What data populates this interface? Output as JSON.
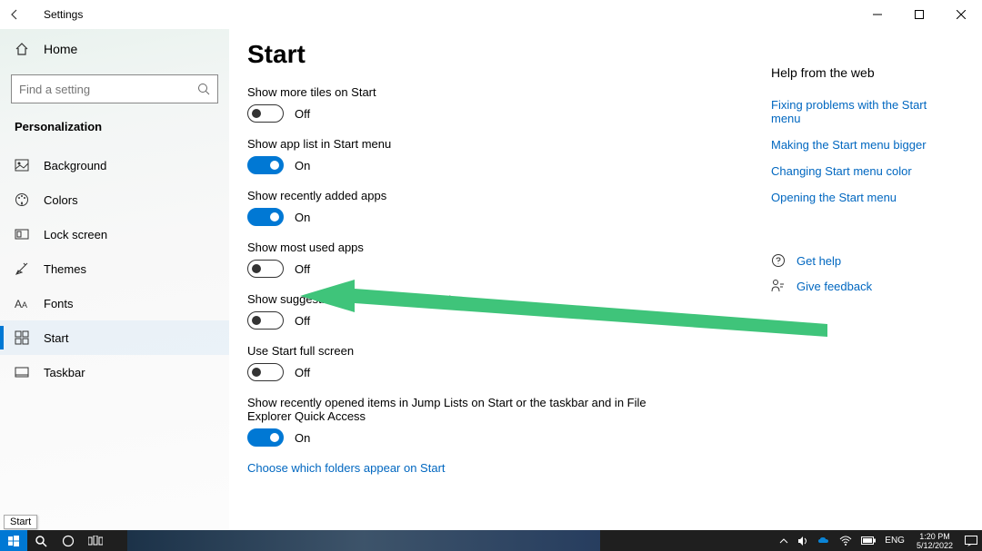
{
  "titlebar": {
    "title": "Settings"
  },
  "sidebar": {
    "home": "Home",
    "search_placeholder": "Find a setting",
    "category": "Personalization",
    "items": [
      {
        "label": "Background",
        "icon": "image"
      },
      {
        "label": "Colors",
        "icon": "palette"
      },
      {
        "label": "Lock screen",
        "icon": "lock"
      },
      {
        "label": "Themes",
        "icon": "brush"
      },
      {
        "label": "Fonts",
        "icon": "font"
      },
      {
        "label": "Start",
        "icon": "start",
        "active": true
      },
      {
        "label": "Taskbar",
        "icon": "taskbar"
      }
    ]
  },
  "page": {
    "title": "Start",
    "options": [
      {
        "label": "Show more tiles on Start",
        "on": false,
        "state": "Off"
      },
      {
        "label": "Show app list in Start menu",
        "on": true,
        "state": "On"
      },
      {
        "label": "Show recently added apps",
        "on": true,
        "state": "On"
      },
      {
        "label": "Show most used apps",
        "on": false,
        "state": "Off"
      },
      {
        "label": "Show suggestions occasionally in Start",
        "on": false,
        "state": "Off"
      },
      {
        "label": "Use Start full screen",
        "on": false,
        "state": "Off"
      },
      {
        "label": "Show recently opened items in Jump Lists on Start or the taskbar and in File Explorer Quick Access",
        "on": true,
        "state": "On"
      }
    ],
    "folders_link": "Choose which folders appear on Start"
  },
  "help": {
    "heading": "Help from the web",
    "links": [
      "Fixing problems with the Start menu",
      "Making the Start menu bigger",
      "Changing Start menu color",
      "Opening the Start menu"
    ],
    "get_help": "Get help",
    "feedback": "Give feedback"
  },
  "tooltip": "Start",
  "taskbar": {
    "lang": "ENG",
    "time": "1:20 PM",
    "date": "5/12/2022"
  }
}
